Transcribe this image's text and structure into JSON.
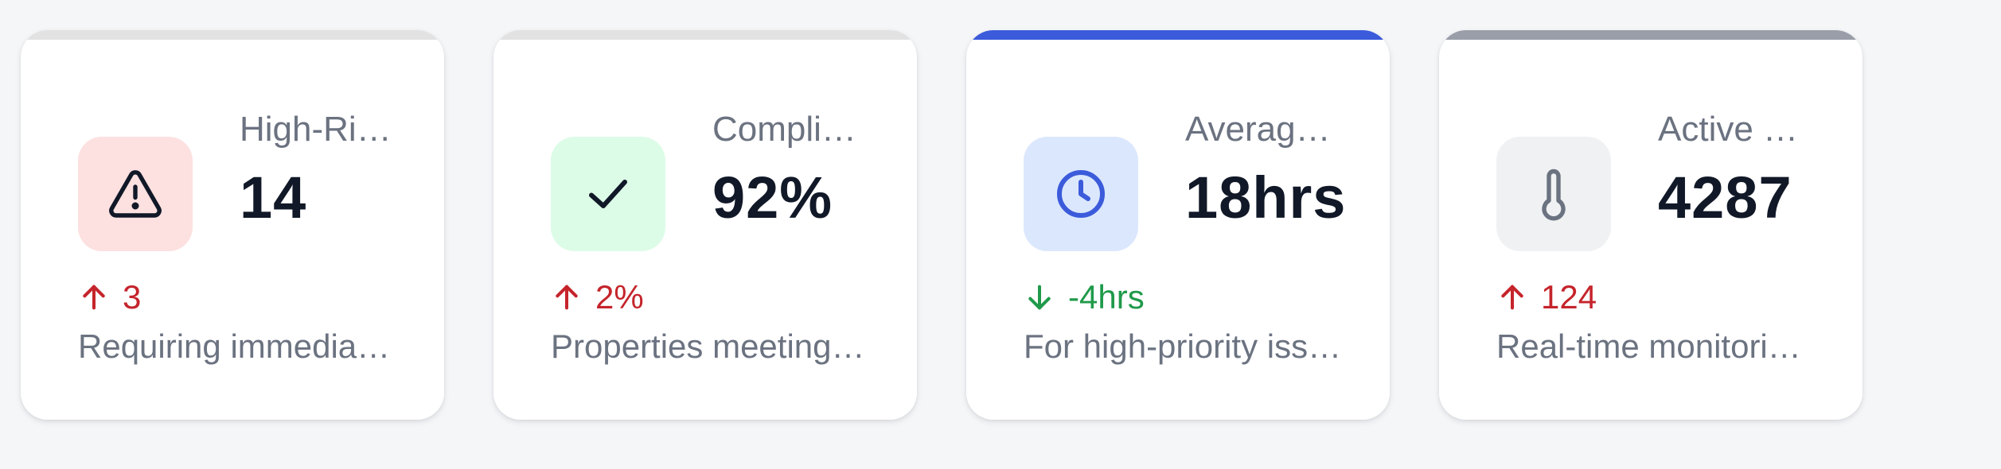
{
  "colors": {
    "page_bg": "#f5f6f8",
    "trend_up": "#c5242b",
    "trend_down": "#1f9a4a"
  },
  "cards": [
    {
      "label": "High-Risk Properties",
      "value": "14",
      "change": "3",
      "change_direction": "up",
      "description": "Requiring immediate attention",
      "icon": "warning-triangle-icon",
      "accent_color": "#e2e2e2",
      "icon_bg": "#fde0e0",
      "icon_color": "#111827"
    },
    {
      "label": "Compliance Rate",
      "value": "92%",
      "change": "2%",
      "change_direction": "up",
      "description": "Properties meeting standards",
      "icon": "checkmark-icon",
      "accent_color": "#e2e2e2",
      "icon_bg": "#dcfce7",
      "icon_color": "#111827"
    },
    {
      "label": "Average Response Time",
      "value": "18hrs",
      "change": "-4hrs",
      "change_direction": "down",
      "description": "For high-priority issues",
      "icon": "clock-icon",
      "accent_color": "#3b5bdb",
      "icon_bg": "#dbe7fd",
      "icon_color": "#3b5bdb"
    },
    {
      "label": "Active Sensors",
      "value": "4287",
      "change": "124",
      "change_direction": "up",
      "description": "Real-time monitoring devices",
      "icon": "thermometer-icon",
      "accent_color": "#9a9ea8",
      "icon_bg": "#f0f1f3",
      "icon_color": "#6b7280"
    }
  ]
}
